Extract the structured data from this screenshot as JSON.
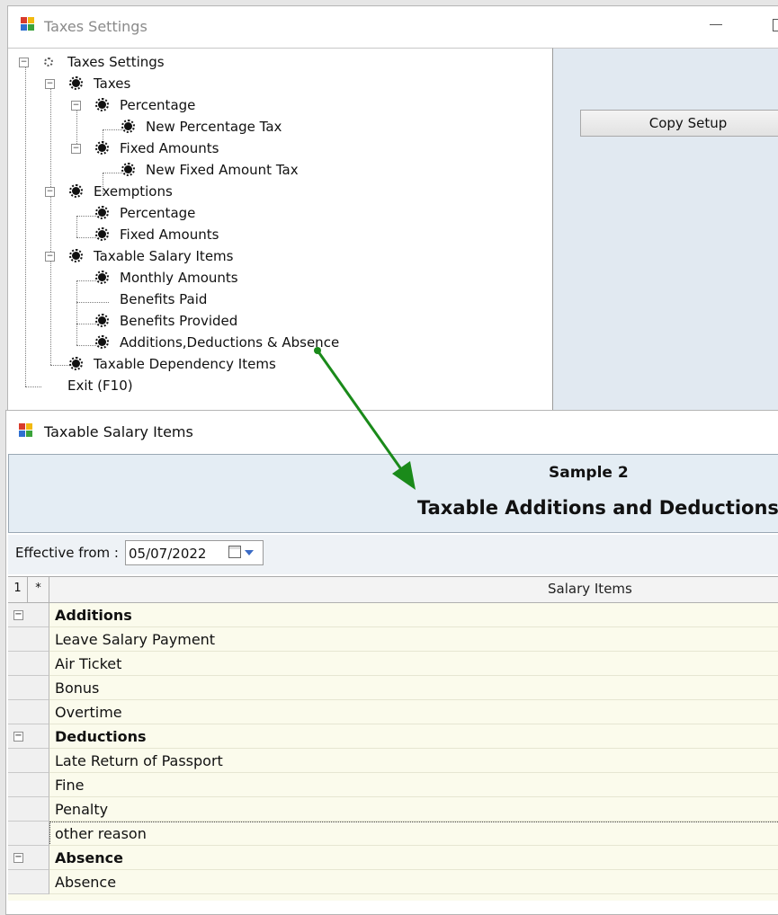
{
  "top_window": {
    "title": "Taxes Settings",
    "copy_button": "Copy Setup",
    "tree": {
      "root": "Taxes Settings",
      "taxes": "Taxes",
      "taxes_percentage": "Percentage",
      "new_percentage_tax": "New Percentage Tax",
      "taxes_fixed_amounts": "Fixed Amounts",
      "new_fixed_amount_tax": "New Fixed Amount Tax",
      "exemptions": "Exemptions",
      "exemptions_percentage": "Percentage",
      "exemptions_fixed_amounts": "Fixed Amounts",
      "taxable_salary_items": "Taxable Salary Items",
      "monthly_amounts": "Monthly Amounts",
      "benefits_paid": "Benefits Paid",
      "benefits_provided": "Benefits Provided",
      "additions_deductions_absence": "Additions,Deductions & Absence",
      "taxable_dependency_items": "Taxable Dependency Items",
      "exit": "Exit (F10)"
    }
  },
  "bottom_window": {
    "title": "Taxable Salary Items",
    "sample_title": "Sample 2",
    "report_title": "Taxable Additions and Deductions",
    "effective_label": "Effective from :",
    "effective_date": "05/07/2022",
    "grid": {
      "col_num": "1",
      "col_star": "*",
      "col_items": "Salary Items",
      "rows": [
        {
          "text": "Additions",
          "group": true
        },
        {
          "text": "Leave Salary Payment",
          "group": false
        },
        {
          "text": "Air Ticket",
          "group": false
        },
        {
          "text": "Bonus",
          "group": false
        },
        {
          "text": "Overtime",
          "group": false
        },
        {
          "text": "Deductions",
          "group": true
        },
        {
          "text": "Late Return of Passport",
          "group": false
        },
        {
          "text": "Fine",
          "group": false
        },
        {
          "text": "Penalty",
          "group": false
        },
        {
          "text": "other reason",
          "group": false
        },
        {
          "text": "Absence",
          "group": true
        },
        {
          "text": "Absence",
          "group": false
        }
      ]
    }
  },
  "colors": {
    "arrow": "#1a8a1a",
    "header_band": "#e4edf4",
    "grid_bg": "#fbfbec"
  }
}
